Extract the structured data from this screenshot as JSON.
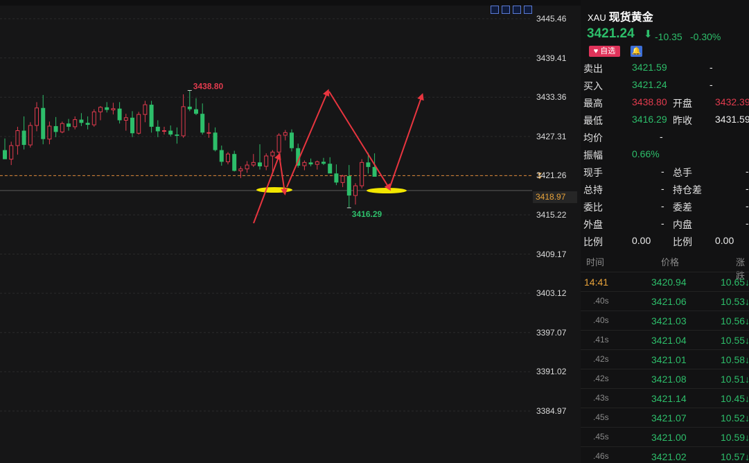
{
  "toolbar": {
    "icons": [
      "crosshair-icon",
      "indicator-icon",
      "play-icon",
      "layout-icon"
    ]
  },
  "chart": {
    "y_ticks": [
      "3445.46",
      "3439.41",
      "3433.36",
      "3427.31",
      "3421.26",
      "3415.22",
      "3409.17",
      "3403.12",
      "3397.07",
      "3391.02",
      "3384.97"
    ],
    "current_price_label": "3418.97",
    "high_label": "3438.80",
    "low_label": "3416.29"
  },
  "chart_data": {
    "type": "candlestick",
    "ylim": [
      3381,
      3448
    ],
    "candles": [
      {
        "o": 3425.2,
        "h": 3427.0,
        "l": 3423.8,
        "c": 3423.8
      },
      {
        "o": 3423.8,
        "h": 3426.5,
        "l": 3422.9,
        "c": 3425.9
      },
      {
        "o": 3425.9,
        "h": 3428.8,
        "l": 3424.5,
        "c": 3428.2
      },
      {
        "o": 3428.2,
        "h": 3430.4,
        "l": 3425.3,
        "c": 3426.0
      },
      {
        "o": 3426.0,
        "h": 3429.5,
        "l": 3425.6,
        "c": 3429.0
      },
      {
        "o": 3429.0,
        "h": 3432.6,
        "l": 3428.1,
        "c": 3431.7
      },
      {
        "o": 3431.7,
        "h": 3433.7,
        "l": 3426.1,
        "c": 3426.9
      },
      {
        "o": 3426.9,
        "h": 3429.6,
        "l": 3426.1,
        "c": 3428.9
      },
      {
        "o": 3428.9,
        "h": 3430.3,
        "l": 3427.2,
        "c": 3428.0
      },
      {
        "o": 3428.0,
        "h": 3429.6,
        "l": 3427.8,
        "c": 3429.3
      },
      {
        "o": 3429.3,
        "h": 3430.0,
        "l": 3428.2,
        "c": 3428.8
      },
      {
        "o": 3428.8,
        "h": 3430.4,
        "l": 3428.4,
        "c": 3429.9
      },
      {
        "o": 3429.9,
        "h": 3430.9,
        "l": 3428.9,
        "c": 3429.4
      },
      {
        "o": 3429.4,
        "h": 3430.4,
        "l": 3428.4,
        "c": 3429.1
      },
      {
        "o": 3429.1,
        "h": 3431.5,
        "l": 3428.8,
        "c": 3431.1
      },
      {
        "o": 3431.1,
        "h": 3432.0,
        "l": 3429.8,
        "c": 3431.8
      },
      {
        "o": 3431.8,
        "h": 3432.6,
        "l": 3431.0,
        "c": 3431.4
      },
      {
        "o": 3431.4,
        "h": 3432.5,
        "l": 3430.7,
        "c": 3431.6
      },
      {
        "o": 3431.6,
        "h": 3432.6,
        "l": 3429.3,
        "c": 3429.8
      },
      {
        "o": 3429.8,
        "h": 3430.8,
        "l": 3428.2,
        "c": 3430.2
      },
      {
        "o": 3430.2,
        "h": 3431.2,
        "l": 3427.2,
        "c": 3427.8
      },
      {
        "o": 3427.8,
        "h": 3431.1,
        "l": 3427.6,
        "c": 3430.7
      },
      {
        "o": 3430.7,
        "h": 3432.8,
        "l": 3429.5,
        "c": 3432.2
      },
      {
        "o": 3432.2,
        "h": 3432.8,
        "l": 3427.9,
        "c": 3428.8
      },
      {
        "o": 3428.8,
        "h": 3429.8,
        "l": 3427.2,
        "c": 3428.1
      },
      {
        "o": 3428.1,
        "h": 3428.8,
        "l": 3427.6,
        "c": 3428.2
      },
      {
        "o": 3428.2,
        "h": 3429.0,
        "l": 3427.3,
        "c": 3427.6
      },
      {
        "o": 3427.6,
        "h": 3428.7,
        "l": 3426.2,
        "c": 3427.4
      },
      {
        "o": 3427.4,
        "h": 3433.8,
        "l": 3427.1,
        "c": 3431.9
      },
      {
        "o": 3431.9,
        "h": 3434.4,
        "l": 3431.2,
        "c": 3431.5
      },
      {
        "o": 3431.5,
        "h": 3433.2,
        "l": 3430.6,
        "c": 3430.8
      },
      {
        "o": 3430.8,
        "h": 3432.4,
        "l": 3427.6,
        "c": 3427.9
      },
      {
        "o": 3427.9,
        "h": 3429.4,
        "l": 3427.1,
        "c": 3427.9
      },
      {
        "o": 3427.9,
        "h": 3428.7,
        "l": 3425.0,
        "c": 3425.2
      },
      {
        "o": 3425.2,
        "h": 3425.9,
        "l": 3422.8,
        "c": 3423.4
      },
      {
        "o": 3423.4,
        "h": 3424.9,
        "l": 3423.0,
        "c": 3424.6
      },
      {
        "o": 3424.6,
        "h": 3425.1,
        "l": 3421.9,
        "c": 3422.0
      },
      {
        "o": 3422.0,
        "h": 3422.7,
        "l": 3420.9,
        "c": 3422.3
      },
      {
        "o": 3422.3,
        "h": 3423.5,
        "l": 3421.7,
        "c": 3422.9
      },
      {
        "o": 3422.9,
        "h": 3424.6,
        "l": 3422.6,
        "c": 3423.3
      },
      {
        "o": 3423.3,
        "h": 3426.1,
        "l": 3422.2,
        "c": 3422.7
      },
      {
        "o": 3422.7,
        "h": 3424.7,
        "l": 3422.1,
        "c": 3424.3
      },
      {
        "o": 3424.3,
        "h": 3425.2,
        "l": 3421.8,
        "c": 3424.9
      },
      {
        "o": 3424.9,
        "h": 3427.8,
        "l": 3424.0,
        "c": 3427.5
      },
      {
        "o": 3427.5,
        "h": 3428.3,
        "l": 3426.7,
        "c": 3427.9
      },
      {
        "o": 3427.9,
        "h": 3428.4,
        "l": 3425.0,
        "c": 3425.5
      },
      {
        "o": 3425.5,
        "h": 3426.2,
        "l": 3422.5,
        "c": 3422.8
      },
      {
        "o": 3422.8,
        "h": 3423.6,
        "l": 3422.1,
        "c": 3423.3
      },
      {
        "o": 3423.3,
        "h": 3423.9,
        "l": 3422.7,
        "c": 3423.0
      },
      {
        "o": 3423.0,
        "h": 3423.6,
        "l": 3422.2,
        "c": 3423.4
      },
      {
        "o": 3423.4,
        "h": 3424.0,
        "l": 3422.9,
        "c": 3423.1
      },
      {
        "o": 3423.1,
        "h": 3424.1,
        "l": 3422.1,
        "c": 3421.6
      },
      {
        "o": 3421.6,
        "h": 3423.0,
        "l": 3419.8,
        "c": 3420.2
      },
      {
        "o": 3420.2,
        "h": 3421.4,
        "l": 3419.5,
        "c": 3421.2
      },
      {
        "o": 3421.2,
        "h": 3422.9,
        "l": 3416.3,
        "c": 3418.2
      },
      {
        "o": 3418.2,
        "h": 3420.1,
        "l": 3416.8,
        "c": 3419.7
      },
      {
        "o": 3419.7,
        "h": 3423.8,
        "l": 3419.3,
        "c": 3423.3
      },
      {
        "o": 3423.3,
        "h": 3424.8,
        "l": 3421.6,
        "c": 3422.6
      },
      {
        "o": 3422.6,
        "h": 3424.7,
        "l": 3421.2,
        "c": 3421.1
      }
    ]
  },
  "quote": {
    "symbol_code": "XAU",
    "symbol_name": "现货黄金",
    "price": "3421.24",
    "change": "-10.35",
    "change_pct": "-0.30%",
    "fav_label": "自选",
    "rows": [
      {
        "l1": "卖出",
        "v1": "3421.59",
        "l2": "",
        "v2": "-"
      },
      {
        "l1": "买入",
        "v1": "3421.24",
        "l2": "",
        "v2": "-"
      },
      {
        "l1": "最高",
        "v1": "3438.80",
        "l2": "开盘",
        "v2": "3432.39"
      },
      {
        "l1": "最低",
        "v1": "3416.29",
        "l2": "昨收",
        "v2": "3431.59"
      },
      {
        "l1": "均价",
        "v1": "-",
        "l2": "",
        "v2": ""
      },
      {
        "l1": "振幅",
        "v1": "0.66%",
        "l2": "",
        "v2": ""
      },
      {
        "l1": "现手",
        "v1": "-",
        "l2": "总手",
        "v2": "-"
      },
      {
        "l1": "总持",
        "v1": "-",
        "l2": "持仓差",
        "v2": "-"
      },
      {
        "l1": "委比",
        "v1": "-",
        "l2": "委差",
        "v2": "-"
      },
      {
        "l1": "外盘",
        "v1": "-",
        "l2": "内盘",
        "v2": "-"
      },
      {
        "l1": "比例",
        "v1": "0.00",
        "l2": "比例",
        "v2": "0.00"
      }
    ]
  },
  "trades": {
    "headers": [
      "时间",
      "价格",
      "涨跌"
    ],
    "rows": [
      {
        "t": "14:41",
        "p": "3420.94",
        "c": "10.65"
      },
      {
        "t": ".40s",
        "p": "3421.06",
        "c": "10.53"
      },
      {
        "t": ".40s",
        "p": "3421.03",
        "c": "10.56"
      },
      {
        "t": ".41s",
        "p": "3421.04",
        "c": "10.55"
      },
      {
        "t": ".42s",
        "p": "3421.01",
        "c": "10.58"
      },
      {
        "t": ".42s",
        "p": "3421.08",
        "c": "10.51"
      },
      {
        "t": ".43s",
        "p": "3421.14",
        "c": "10.45"
      },
      {
        "t": ".45s",
        "p": "3421.07",
        "c": "10.52"
      },
      {
        "t": ".45s",
        "p": "3421.00",
        "c": "10.59"
      },
      {
        "t": ".46s",
        "p": "3421.02",
        "c": "10.57"
      }
    ]
  },
  "colors": {
    "up": "#e23b4e",
    "down": "#2dbe6a",
    "highlight": "#f2e600",
    "annotation": "#e8353f",
    "dashed_line": "#e28a3a"
  }
}
